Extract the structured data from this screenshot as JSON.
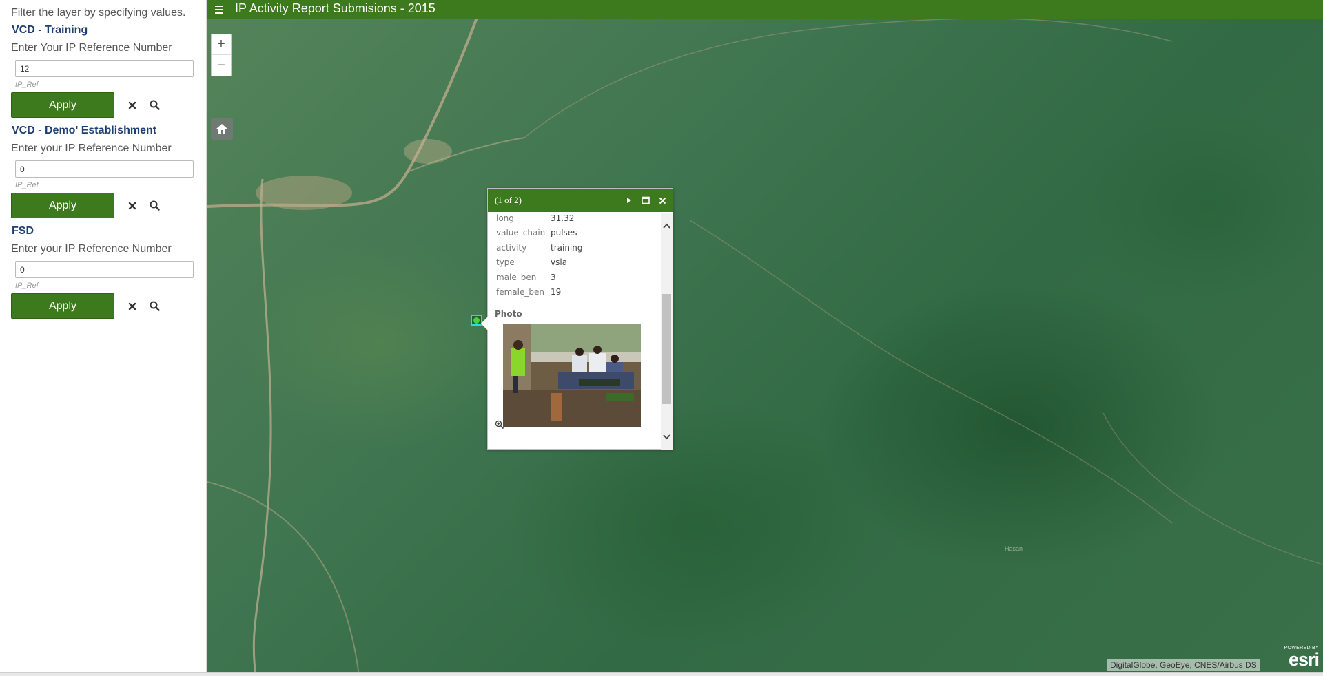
{
  "app": {
    "title": "IP Activity Report Submisions - 2015"
  },
  "sidebar": {
    "intro": "Filter the layer by specifying values.",
    "apply_label": "Apply",
    "sections": [
      {
        "title": "VCD - Training",
        "prompt": "Enter Your IP Reference Number",
        "value": "12",
        "hint": "IP_Ref"
      },
      {
        "title": "VCD - Demo' Establishment",
        "prompt": "Enter your IP Reference Number",
        "value": "0",
        "hint": "IP_Ref"
      },
      {
        "title": "FSD",
        "prompt": "Enter your IP Reference Number",
        "value": "0",
        "hint": "IP_Ref"
      }
    ]
  },
  "map": {
    "zoom_in": "+",
    "zoom_out": "−",
    "place_label": "Hasan",
    "attribution": "DigitalGlobe, GeoEye, CNES/Airbus DS",
    "logo": {
      "powered": "POWERED BY",
      "word": "esri"
    }
  },
  "popup": {
    "count": "(1 of 2)",
    "fields": [
      {
        "key": "long",
        "value": "31.32"
      },
      {
        "key": "value_chain",
        "value": "pulses"
      },
      {
        "key": "activity",
        "value": "training"
      },
      {
        "key": "type",
        "value": "vsla"
      },
      {
        "key": "male_ben",
        "value": "3"
      },
      {
        "key": "female_ben",
        "value": "19"
      }
    ],
    "photo_heading": "Photo"
  },
  "colors": {
    "header": "#3d7a1e",
    "section_title": "#1f3f73",
    "marker_outline": "#17e3f0"
  }
}
